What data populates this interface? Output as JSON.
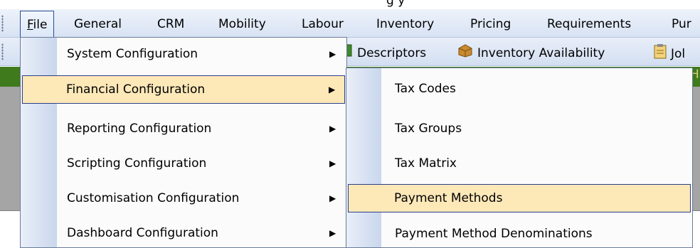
{
  "window": {
    "title_fragment": "g           y"
  },
  "menubar": {
    "items": [
      "File",
      "General",
      "CRM",
      "Mobility",
      "Labour",
      "Inventory",
      "Pricing",
      "Requirements",
      "Pur"
    ],
    "active": "File"
  },
  "toolbar": {
    "items": [
      {
        "label": "Descriptors",
        "icon": "descriptors-icon"
      },
      {
        "label": "Inventory Availability",
        "icon": "inventory-availability-icon"
      },
      {
        "label": "Jol",
        "icon": "job-icon"
      }
    ]
  },
  "strip": {
    "trailing_char": "H"
  },
  "file_menu": {
    "items": [
      {
        "label": "System Configuration",
        "submenu": true
      },
      {
        "label": "Financial Configuration",
        "submenu": true,
        "highlighted": true
      },
      {
        "label": "Reporting Configuration",
        "submenu": true
      },
      {
        "label": "Scripting Configuration",
        "submenu": true
      },
      {
        "label": "Customisation Configuration",
        "submenu": true
      },
      {
        "label": "Dashboard Configuration",
        "submenu": true
      }
    ],
    "arrow_glyph": "▶"
  },
  "financial_submenu": {
    "items": [
      {
        "label": "Tax Codes"
      },
      {
        "label": "Tax Groups"
      },
      {
        "label": "Tax Matrix"
      },
      {
        "label": "Payment Methods",
        "highlighted": true
      },
      {
        "label": "Payment Method Denominations"
      }
    ]
  },
  "colors": {
    "highlight_fill": "#fde8b8",
    "highlight_border": "#2a3f8a",
    "strip_green": "#3f7a1d",
    "workspace_gray": "#a5a5a5"
  }
}
